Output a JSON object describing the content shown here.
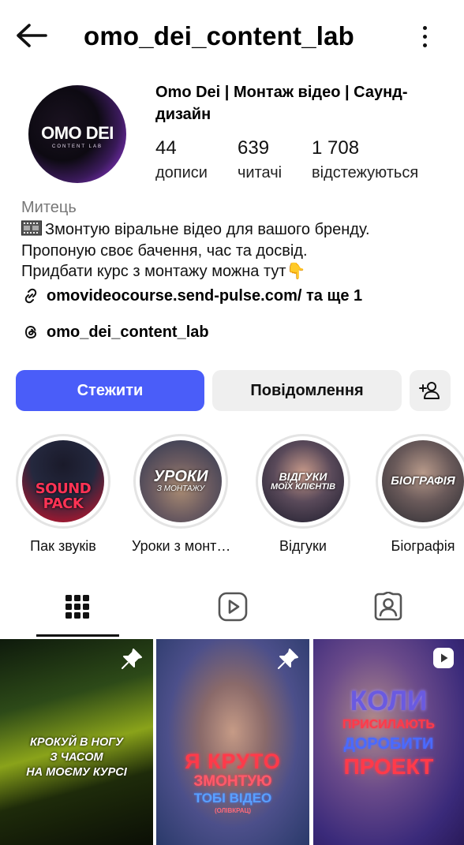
{
  "header": {
    "username": "omo_dei_content_lab"
  },
  "profile": {
    "avatar_logo_main": "OMO DEI",
    "avatar_logo_sub": "CONTENT LAB",
    "display_name": "Omo Dei | Монтаж відео | Саунд-дизайн",
    "stats": {
      "posts": {
        "value": "44",
        "label": "дописи"
      },
      "followers": {
        "value": "639",
        "label": "читачі"
      },
      "following": {
        "value": "1 708",
        "label": "відстежуються"
      }
    },
    "category": "Митець",
    "bio_line_1": "Змонтую віральне відео для вашого бренду.",
    "bio_line_2": "Пропоную своє бачення, час та досвід.",
    "bio_line_3": "Придбати курс з монтажу можна тут👇",
    "link_text": "omovideocourse.send-pulse.com/ та ще 1",
    "threads_handle": "omo_dei_content_lab"
  },
  "actions": {
    "follow_label": "Стежити",
    "message_label": "Повідомлення"
  },
  "highlights": [
    {
      "label": "Пак звуків",
      "cover_text": "SOUND PACK"
    },
    {
      "label": "Уроки з монт…",
      "cover_text_1": "УРОКИ",
      "cover_text_2": "З МОНТАЖУ"
    },
    {
      "label": "Відгуки",
      "cover_text_1": "ВІДГУКИ",
      "cover_text_2": "МОЇХ КЛІЄНТІВ"
    },
    {
      "label": "Біографія",
      "cover_text": "БІОГРАФІЯ"
    }
  ],
  "tabs": [
    {
      "name": "grid-icon"
    },
    {
      "name": "reels-icon"
    },
    {
      "name": "tagged-icon"
    }
  ],
  "posts": [
    {
      "text_1": "КРОКУЙ В НОГУ",
      "text_2": "З ЧАСОМ",
      "text_3": "НА МОЄМУ КУРСІ",
      "badge": "pin-icon"
    },
    {
      "text_1": "Я КРУТО",
      "text_2": "ЗМОНТУЮ",
      "text_3": "ТОБІ ВІДЕО",
      "text_4": "(ОЛІВКРАЦ)",
      "badge": "pin-icon"
    },
    {
      "text_1": "КОЛИ",
      "text_2": "ПРИСИЛАЮТЬ",
      "text_3": "ДОРОБИТИ",
      "text_4": "ПРОЕКТ",
      "badge": "reel-icon"
    }
  ],
  "colors": {
    "follow_button": "#4a5df9",
    "secondary_button": "#efefef",
    "category_text": "#777777"
  }
}
